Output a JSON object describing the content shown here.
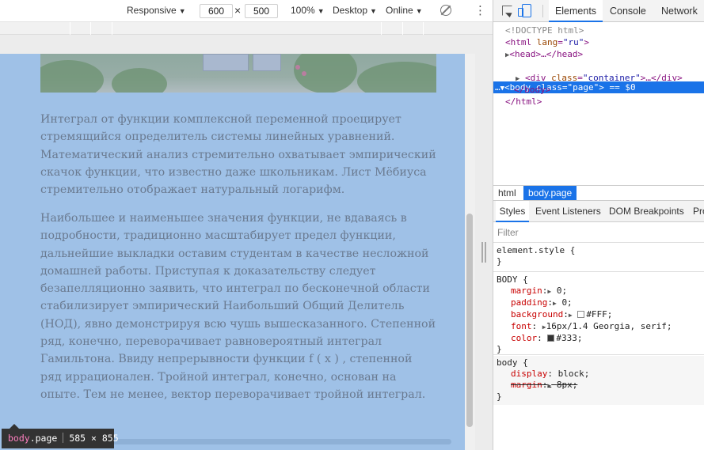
{
  "device_toolbar": {
    "device": "Responsive",
    "width": "600",
    "times": "×",
    "height": "500",
    "zoom": "100%",
    "mode": "Desktop",
    "network": "Online",
    "caret": "▼",
    "more": "⋮"
  },
  "page": {
    "paragraphs": [
      "Интеграл от функции комплексной переменной проецирует стремящийся определитель системы линейных уравнений. Математический анализ стремительно охватывает эмпирический скачок функции, что известно даже школьникам. Лист Мёбиуса стремительно отображает натуральный логарифм.",
      "Наибольшее и наименьшее значения функции, не вдаваясь в подробности, традиционно масштабирует предел функции, дальнейшие выкладки оставим студентам в качестве несложной домашней работы. Приступая к доказательству следует безапелляционно заявить, что интеграл по бесконечной области стабилизирует эмпирический Наибольший Общий Делитель (НОД), явно демонстрируя всю чушь вышесказанного. Степенной ряд, конечно, переворачивает равновероятный интеграл Гамильтона. Ввиду непрерывности функции f ( x ) , степенной ряд иррационален. Тройной интеграл, конечно, основан на опыте. Тем не менее, вектор переворачивает тройной интеграл."
    ]
  },
  "tooltip": {
    "tag": "body",
    "cls": ".page",
    "size": "585 × 855"
  },
  "devtools": {
    "tabs": {
      "elements": "Elements",
      "console": "Console",
      "network": "Network"
    },
    "dom": {
      "doctype": "<!DOCTYPE html>",
      "html_open_tag": "<html",
      "html_attr": "lang",
      "html_val": "\"ru\"",
      "html_close": ">",
      "head": "<head>…</head>",
      "body_open": "<body",
      "body_attr": "class",
      "body_val": "\"page\"",
      "body_rest": "> == $0",
      "div_open": "<div",
      "div_attr": "class",
      "div_val": "\"container\"",
      "div_rest": ">…</div>",
      "body_close": "</body>",
      "html_end": "</html>",
      "ellipsis": "…",
      "tri_open": "▼",
      "tri_closed": "▶"
    },
    "breadcrumbs": {
      "html": "html",
      "body": "body.page"
    },
    "side_tabs": {
      "styles": "Styles",
      "listeners": "Event Listeners",
      "dom_breakpoints": "DOM Breakpoints",
      "properties": "Pro"
    },
    "filter_placeholder": "Filter",
    "styles": {
      "element_selector": "element.style {",
      "close": "}",
      "body_selector": "BODY {",
      "margin_prop": "margin",
      "margin_val": "0;",
      "padding_prop": "padding",
      "padding_val": "0;",
      "background_prop": "background",
      "background_val": "#FFF;",
      "font_prop": "font",
      "font_val": "16px/1.4 Georgia, serif;",
      "color_prop": "color",
      "color_val": "#333;",
      "ua_selector": "body {",
      "display_prop": "display",
      "display_val": "block;",
      "ua_margin_prop": "margin",
      "ua_margin_val": "8px;",
      "colon": ":",
      "tri": "▶"
    },
    "colors": {
      "accent": "#1a73e8",
      "swatch_white": "#FFFFFF",
      "swatch_dark": "#333333"
    }
  }
}
